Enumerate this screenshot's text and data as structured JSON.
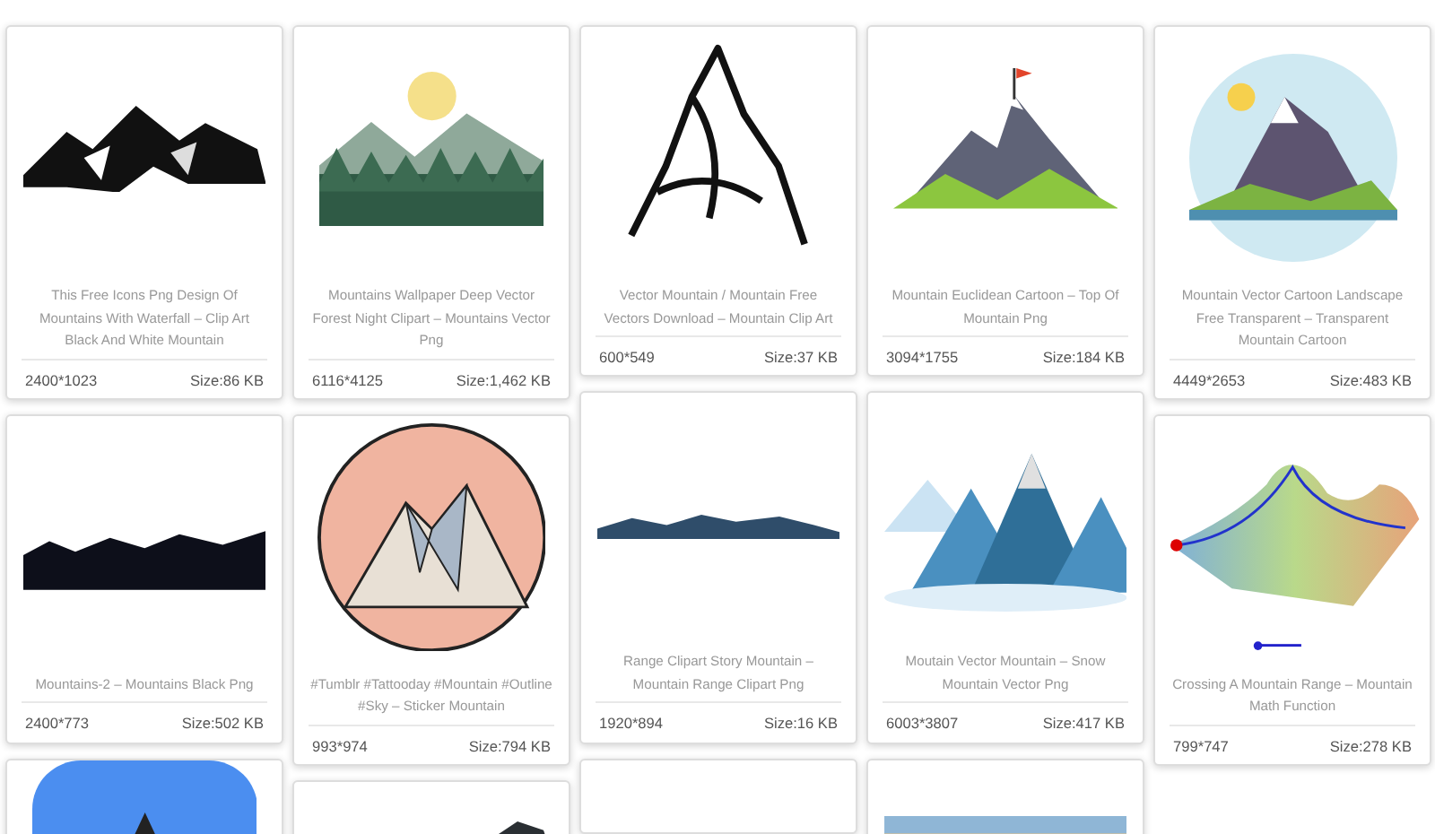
{
  "columns": [
    {
      "cards": [
        {
          "image": {
            "kind": "picture"
          },
          "title": "This Free Icons Png Design Of Mountains With Waterfall – Clip Art Black And White Mountain",
          "dimensions": "2400*1023",
          "size": "Size:86 KB"
        },
        {
          "image": {
            "kind": "picture"
          },
          "title": "Mountains-2 – Mountains Black Png",
          "dimensions": "2400*773",
          "size": "Size:502 KB"
        },
        {
          "image": {
            "kind": "picture"
          }
        }
      ]
    },
    {
      "cards": [
        {
          "image": {
            "kind": "picture"
          },
          "title": "Mountains Wallpaper Deep Vector Forest Night Clipart – Mountains Vector Png",
          "dimensions": "6116*4125",
          "size": "Size:1,462 KB"
        },
        {
          "image": {
            "kind": "picture"
          },
          "title": "#Tumblr #Tattooday #Mountain #Outline #Sky – Sticker Mountain",
          "dimensions": "993*974",
          "size": "Size:794 KB"
        },
        {
          "image": {
            "kind": "picture"
          }
        }
      ]
    },
    {
      "cards": [
        {
          "image": {
            "kind": "picture"
          },
          "title": "Vector Mountain / Mountain Free Vectors Download – Mountain Clip Art",
          "dimensions": "600*549",
          "size": "Size:37 KB"
        },
        {
          "image": {
            "kind": "picture"
          },
          "title": "Range Clipart Story Mountain – Mountain Range Clipart Png",
          "dimensions": "1920*894",
          "size": "Size:16 KB"
        },
        {
          "kind": "placeholder"
        }
      ]
    },
    {
      "cards": [
        {
          "image": {
            "kind": "picture"
          },
          "title": "Mountain Euclidean Cartoon – Top Of Mountain Png",
          "dimensions": "3094*1755",
          "size": "Size:184 KB"
        },
        {
          "image": {
            "kind": "picture"
          },
          "title": "Moutain Vector Mountain – Snow Mountain Vector Png",
          "dimensions": "6003*3807",
          "size": "Size:417 KB"
        },
        {
          "image": {
            "kind": "picture"
          }
        }
      ]
    },
    {
      "cards": [
        {
          "image": {
            "kind": "picture"
          },
          "title": "Mountain Vector Cartoon Landscape Free Transparent – Transparent Mountain Cartoon",
          "dimensions": "4449*2653",
          "size": "Size:483 KB"
        },
        {
          "image": {
            "kind": "picture"
          },
          "title": "Crossing A Mountain Range – Mountain Math Function",
          "dimensions": "799*747",
          "size": "Size:278 KB"
        }
      ]
    }
  ]
}
